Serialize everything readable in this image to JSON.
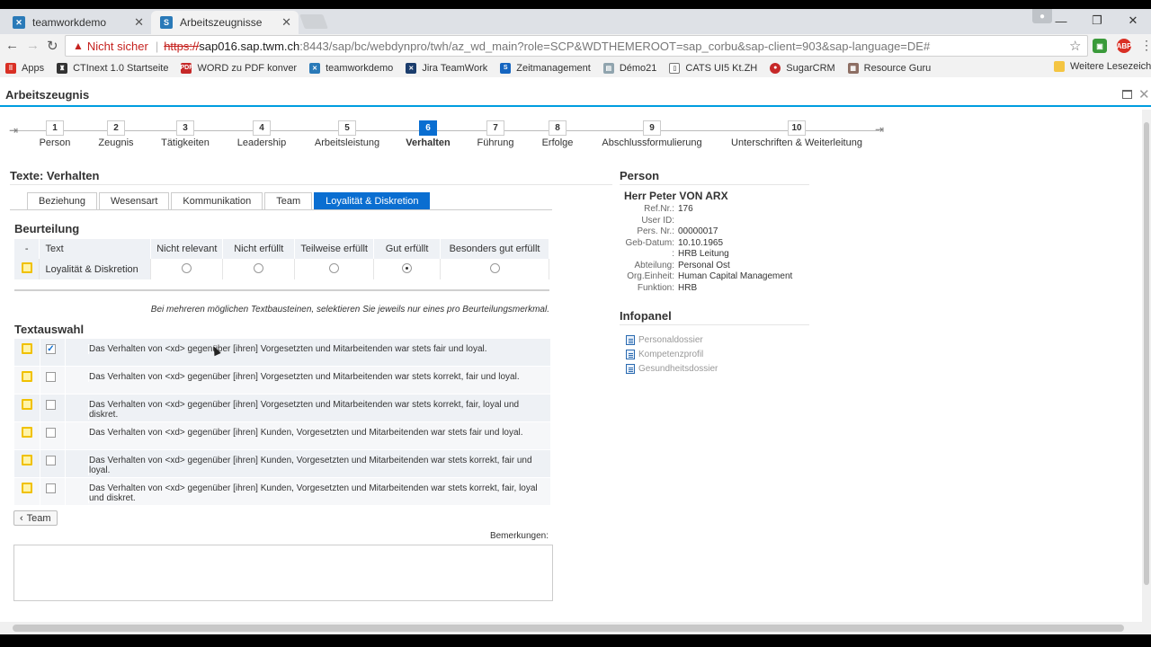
{
  "browser": {
    "tabs": [
      {
        "title": "teamworkdemo",
        "active": false
      },
      {
        "title": "Arbeitszeugnisse",
        "active": true
      }
    ],
    "security_label": "Nicht sicher",
    "url_protocol": "https://",
    "url_host": "sap016.sap.twm.ch",
    "url_path": ":8443/sap/bc/webdynpro/twh/az_wd_main?role=SCP&WDTHEMEROOT=sap_corbu&sap-client=903&sap-language=DE#",
    "bookmarks": [
      "Apps",
      "CTInext 1.0 Startseite",
      "WORD zu PDF konver",
      "teamworkdemo",
      "Jira TeamWork",
      "Zeitmanagement",
      "Démo21",
      "CATS UI5 Kt.ZH",
      "SugarCRM",
      "Resource Guru"
    ],
    "bookmarks_folder": "Weitere Lesezeichen"
  },
  "app": {
    "title": "Arbeitszeugnis"
  },
  "roadmap": {
    "steps": [
      {
        "num": "1",
        "label": "Person"
      },
      {
        "num": "2",
        "label": "Zeugnis"
      },
      {
        "num": "3",
        "label": "Tätigkeiten"
      },
      {
        "num": "4",
        "label": "Leadership"
      },
      {
        "num": "5",
        "label": "Arbeitsleistung"
      },
      {
        "num": "6",
        "label": "Verhalten"
      },
      {
        "num": "7",
        "label": "Führung"
      },
      {
        "num": "8",
        "label": "Erfolge"
      },
      {
        "num": "9",
        "label": "Abschlussformulierung"
      },
      {
        "num": "10",
        "label": "Unterschriften & Weiterleitung"
      }
    ],
    "active_step": "6"
  },
  "main": {
    "section_title": "Texte: Verhalten",
    "subtabs": [
      "Beziehung",
      "Wesensart",
      "Kommunikation",
      "Team",
      "Loyalität & Diskretion"
    ],
    "active_subtab": "Loyalität & Diskretion",
    "beurteilung": {
      "title": "Beurteilung",
      "headers": [
        "-",
        "Text",
        "Nicht relevant",
        "Nicht erfüllt",
        "Teilweise erfüllt",
        "Gut erfüllt",
        "Besonders gut erfüllt"
      ],
      "row": {
        "text": "Loyalität & Diskretion",
        "selected": "Gut erfüllt"
      }
    },
    "hint": "Bei mehreren möglichen Textbausteinen, selektieren Sie jeweils nur eines pro Beurteilungsmerkmal.",
    "textauswahl": {
      "title": "Textauswahl",
      "rows": [
        {
          "text": "Das Verhalten von <xd> gegenüber [ihren] Vorgesetzten und Mitarbeitenden war stets fair und loyal.",
          "checked": true
        },
        {
          "text": "Das Verhalten von <xd> gegenüber [ihren] Vorgesetzten und Mitarbeitenden war stets korrekt, fair und loyal.",
          "checked": false
        },
        {
          "text": "Das Verhalten von <xd> gegenüber [ihren] Vorgesetzten und Mitarbeitenden war stets korrekt, fair, loyal und diskret.",
          "checked": false
        },
        {
          "text": "Das Verhalten von <xd> gegenüber [ihren] Kunden, Vorgesetzten und Mitarbeitenden war stets fair und loyal.",
          "checked": false
        },
        {
          "text": "Das Verhalten von <xd> gegenüber [ihren] Kunden, Vorgesetzten und Mitarbeitenden war stets korrekt, fair und loyal.",
          "checked": false
        },
        {
          "text": "Das Verhalten von <xd> gegenüber [ihren] Kunden, Vorgesetzten und Mitarbeitenden war stets korrekt, fair, loyal und diskret.",
          "checked": false
        }
      ]
    },
    "back_button": "Team",
    "remarks_label": "Bemerkungen:"
  },
  "person": {
    "title": "Person",
    "name": "Herr Peter VON ARX",
    "fields": [
      {
        "label": "Ref.Nr.:",
        "value": "176"
      },
      {
        "label": "User ID:",
        "value": ""
      },
      {
        "label": "Pers. Nr.:",
        "value": "00000017"
      },
      {
        "label": "Geb-Datum:",
        "value": "10.10.1965"
      },
      {
        "label": ":",
        "value": "HRB Leitung"
      },
      {
        "label": "Abteilung:",
        "value": "Personal Ost"
      },
      {
        "label": "Org.Einheit:",
        "value": "Human Capital Management"
      },
      {
        "label": "Funktion:",
        "value": "HRB"
      }
    ]
  },
  "infopanel": {
    "title": "Infopanel",
    "links": [
      "Personaldossier",
      "Kompetenzprofil",
      "Gesundheitsdossier"
    ]
  },
  "colors": {
    "accent": "#0a6ed1",
    "title_line": "#009de0",
    "flag": "#f0c100"
  }
}
